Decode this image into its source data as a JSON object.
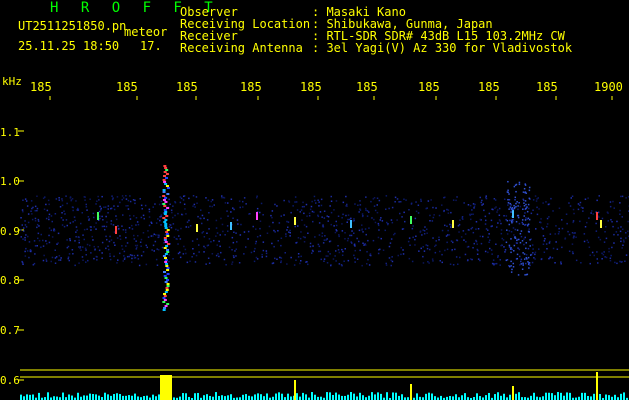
{
  "header": {
    "app_title": "H R O F F T",
    "filename": "UT2511251850.pn",
    "tag": "meteor",
    "datetime": "25.11.25 18:50",
    "count": "17.",
    "info_labels": [
      "Observer",
      "Receiving Location",
      "Receiver",
      "Receiving Antenna"
    ],
    "info_values": [
      ": Masaki Kano",
      ": Shibukawa, Gunma, Japan",
      ": RTL-SDR SDR# 43dB L15 103.2MHz CW",
      ": 3el Yagi(V) Az 330 for Vladivostok"
    ]
  },
  "plot": {
    "y_unit": "kHz",
    "y_ticks": [
      "1.1",
      "1.0",
      "0.9",
      "0.8",
      "0.7",
      "0.6"
    ],
    "x_ticks": [
      "185",
      "185",
      "185",
      "185",
      "185",
      "185",
      "185",
      "185",
      "185",
      "1900"
    ],
    "colors": {
      "text": "#ffff00",
      "title": "#00ff00",
      "grid": "#ffff00",
      "signal_blue": "#1a2a9a",
      "spectrum": "#00ffff"
    }
  }
}
